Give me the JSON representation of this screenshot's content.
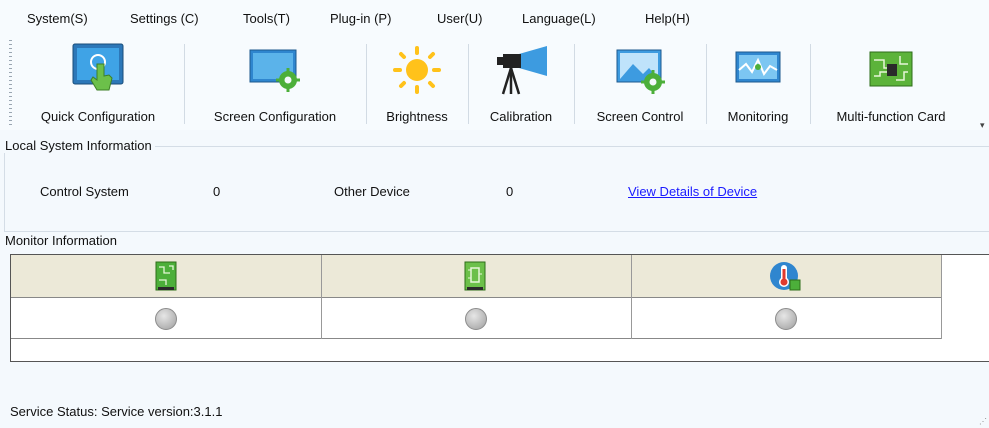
{
  "menu": [
    {
      "label": "System(S)"
    },
    {
      "label": "Settings (C)"
    },
    {
      "label": "Tools(T)"
    },
    {
      "label": "Plug-in (P)"
    },
    {
      "label": "User(U)"
    },
    {
      "label": "Language(L)"
    },
    {
      "label": "Help(H)"
    }
  ],
  "toolbar": [
    {
      "label": "Quick Configuration",
      "icon": "touch-screen-icon"
    },
    {
      "label": "Screen Configuration",
      "icon": "screen-gear-icon"
    },
    {
      "label": "Brightness",
      "icon": "sun-icon"
    },
    {
      "label": "Calibration",
      "icon": "camera-tripod-icon"
    },
    {
      "label": "Screen Control",
      "icon": "picture-gear-icon"
    },
    {
      "label": "Monitoring",
      "icon": "monitor-wave-icon"
    },
    {
      "label": "Multi-function Card",
      "icon": "circuit-board-icon"
    }
  ],
  "local_system": {
    "title": "Local System Information",
    "control_system_label": "Control System",
    "control_system_value": "0",
    "other_device_label": "Other Device",
    "other_device_value": "0",
    "details_link": "View Details of Device"
  },
  "monitor": {
    "title": "Monitor Information",
    "columns": [
      {
        "icon": "sending-card-icon",
        "status": "gray"
      },
      {
        "icon": "receiving-card-icon",
        "status": "gray"
      },
      {
        "icon": "temperature-icon",
        "status": "gray"
      }
    ]
  },
  "status_bar": {
    "label": "Service Status:",
    "value": "Service version:3.1.1"
  },
  "colors": {
    "link": "#1a1aff",
    "header_bg": "#ece9d8",
    "window_bg": "#f4f9fd"
  }
}
